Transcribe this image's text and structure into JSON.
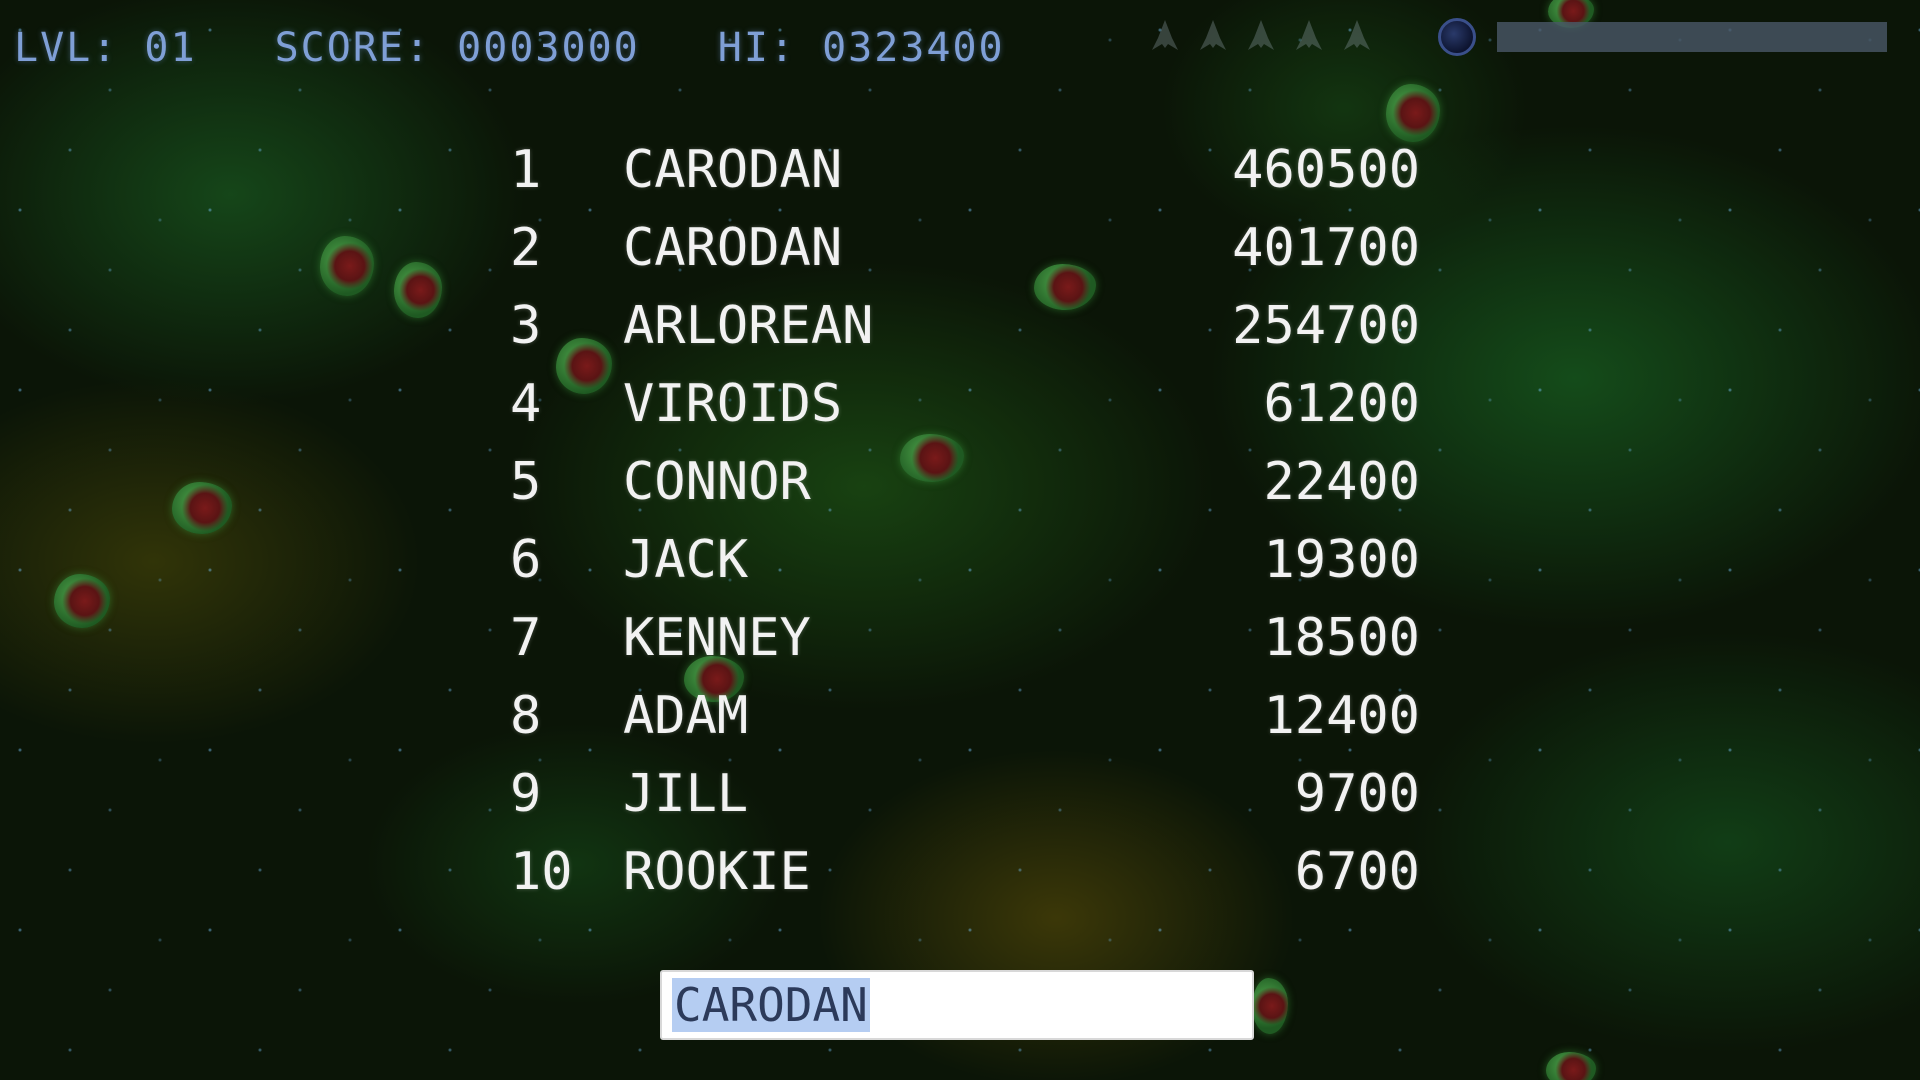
{
  "hud": {
    "level": "LVL: 01",
    "score": "SCORE: 0003000",
    "hi": "HI: 0323400",
    "lives_icon": "ship-icon",
    "lives_count": 5,
    "orb_icon": "orb-icon"
  },
  "leaderboard": [
    {
      "rank": "1",
      "name": "CARODAN",
      "score": "460500"
    },
    {
      "rank": "2",
      "name": "CARODAN",
      "score": "401700"
    },
    {
      "rank": "3",
      "name": "ARLOREAN",
      "score": "254700"
    },
    {
      "rank": "4",
      "name": "VIROIDS",
      "score": "61200"
    },
    {
      "rank": "5",
      "name": "CONNOR",
      "score": "22400"
    },
    {
      "rank": "6",
      "name": "JACK",
      "score": "19300"
    },
    {
      "rank": "7",
      "name": "KENNEY",
      "score": "18500"
    },
    {
      "rank": "8",
      "name": "ADAM",
      "score": "12400"
    },
    {
      "rank": "9",
      "name": "JILL",
      "score": "9700"
    },
    {
      "rank": "10",
      "name": "ROOKIE",
      "score": "6700"
    }
  ],
  "name_entry": {
    "value": "CARODAN"
  },
  "colors": {
    "hud_text": "#7f9fd6",
    "board_text": "#f2f2f2",
    "selection": "#b5cdf2"
  }
}
